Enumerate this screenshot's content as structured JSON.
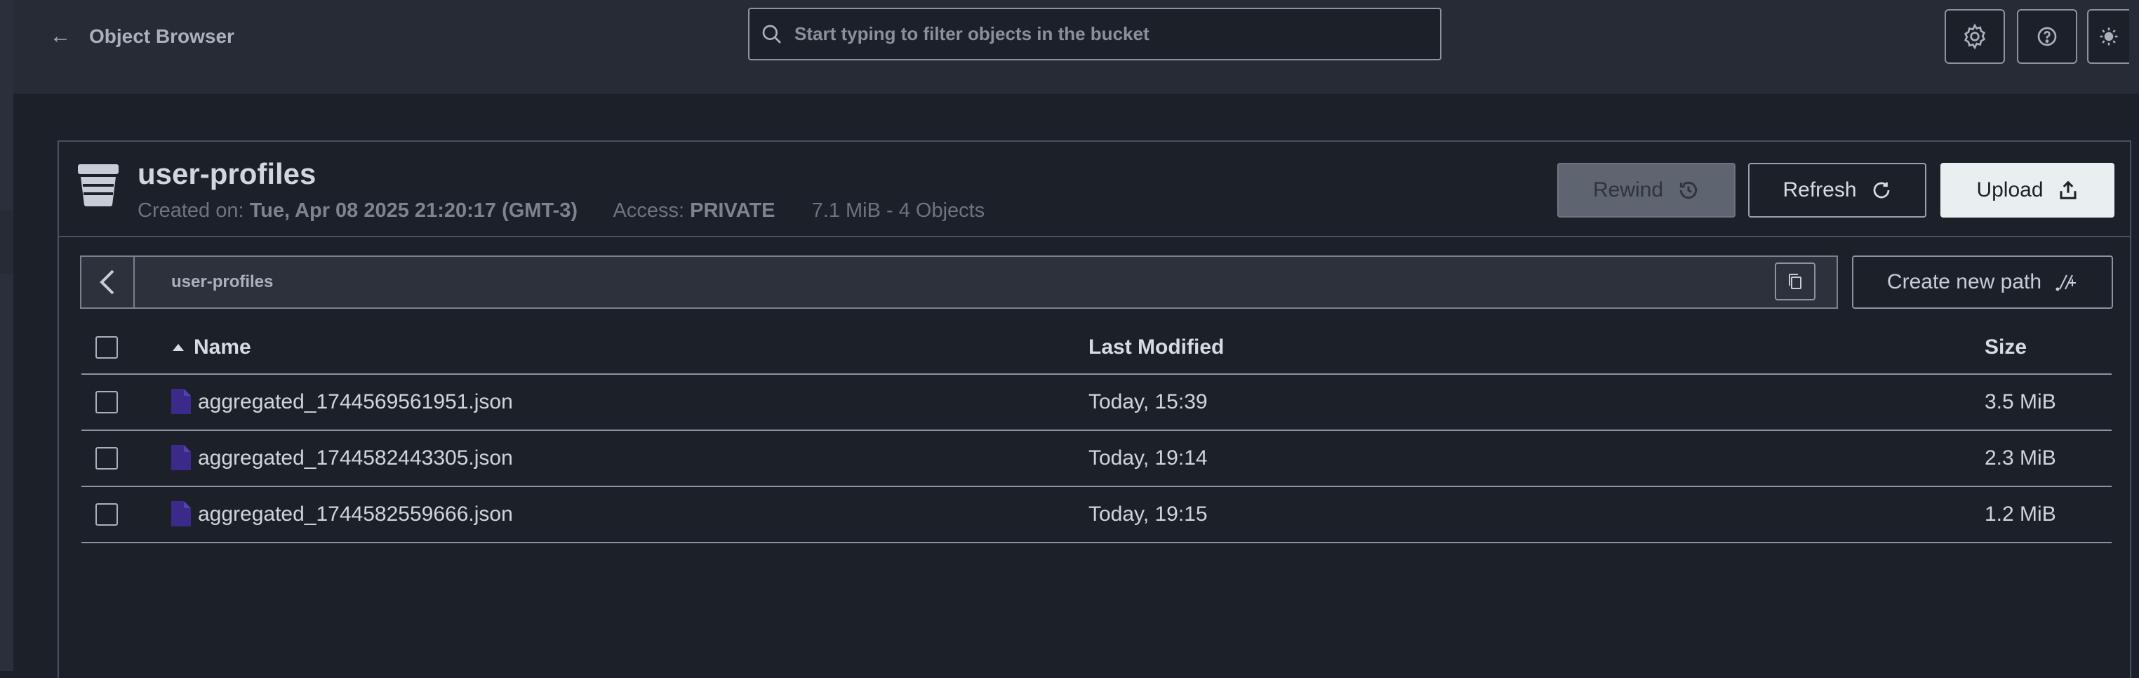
{
  "header": {
    "back_label": "Object Browser",
    "search_placeholder": "Start typing to filter objects in the bucket"
  },
  "bucket": {
    "name": "user-profiles",
    "created_label": "Created on:",
    "created_value": "Tue, Apr 08 2025 21:20:17 (GMT-3)",
    "access_label": "Access:",
    "access_value": "PRIVATE",
    "summary": "7.1 MiB - 4 Objects"
  },
  "actions": {
    "rewind_label": "Rewind",
    "refresh_label": "Refresh",
    "upload_label": "Upload"
  },
  "breadcrumb": {
    "path": "user-profiles",
    "create_path_label": "Create new path"
  },
  "table": {
    "columns": {
      "name": "Name",
      "modified": "Last Modified",
      "size": "Size"
    },
    "sort_direction": "ascending",
    "rows": [
      {
        "name": "aggregated_1744569561951.json",
        "modified": "Today, 15:39",
        "size": "3.5 MiB"
      },
      {
        "name": "aggregated_1744582443305.json",
        "modified": "Today, 19:14",
        "size": "2.3 MiB"
      },
      {
        "name": "aggregated_1744582559666.json",
        "modified": "Today, 19:15",
        "size": "1.2 MiB"
      }
    ]
  },
  "colors": {
    "background": "#1c2029",
    "header": "#262b36",
    "upload_button": "#e9eef0",
    "file_icon": "#3b2a8a"
  },
  "icons": [
    "arrow-left-icon",
    "search-icon",
    "gear-icon",
    "help-icon",
    "sun-icon",
    "bucket-icon",
    "history-icon",
    "refresh-icon",
    "upload-icon",
    "chevron-left-icon",
    "copy-icon",
    "new-path-icon",
    "sort-asc-icon",
    "file-icon"
  ]
}
